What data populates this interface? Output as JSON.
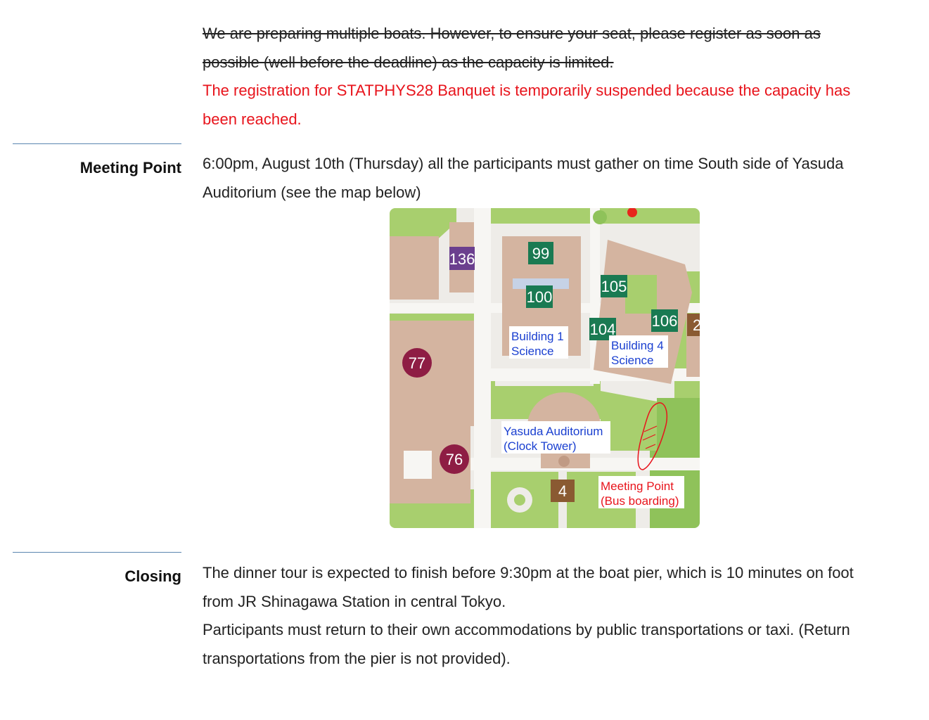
{
  "notice": {
    "strike_text": "We are preparing multiple boats. However, to ensure your seat, please register as soon as possible (well before the deadline) as the capacity is limited.",
    "suspended_text": "The registration for STATPHYS28 Banquet is temporarily suspended because the capacity has been reached."
  },
  "meeting": {
    "label": "Meeting Point",
    "text": "6:00pm, August 10th (Thursday) all the participants must gather on time South side of Yasuda Auditorium (see the map below)"
  },
  "map": {
    "badges": [
      {
        "text": "136",
        "color": "#6b3f8e"
      },
      {
        "text": "99",
        "color": "#1a7a52"
      },
      {
        "text": "100",
        "color": "#1a7a52"
      },
      {
        "text": "105",
        "color": "#1a7a52"
      },
      {
        "text": "106",
        "color": "#1a7a52"
      },
      {
        "text": "104",
        "color": "#1a7a52"
      },
      {
        "text": "2",
        "color": "#8a5a32"
      },
      {
        "text": "77",
        "color": "#8e1d44"
      },
      {
        "text": "76",
        "color": "#8e1d44"
      },
      {
        "text": "4",
        "color": "#8a5a32"
      }
    ],
    "building1": [
      "Building 1",
      "Science"
    ],
    "building4": [
      "Building 4",
      "Science"
    ],
    "yasuda": [
      "Yasuda Auditorium",
      "(Clock Tower)"
    ],
    "meeting_point": [
      "Meeting Point",
      "(Bus boarding)"
    ],
    "colors": {
      "building": "#d4b4a0",
      "park": "#a8cf6e",
      "road": "#f4f2ee",
      "label_blue": "#1a3fd0",
      "label_red": "#e8141c"
    }
  },
  "closing": {
    "label": "Closing",
    "text1": "The dinner tour is expected to finish before 9:30pm at the boat pier, which is 10 minutes on foot from JR Shinagawa Station in central Tokyo.",
    "text2": "Participants must return to their own accommodations by public transportations or taxi. (Return transportations from the pier is not provided)."
  }
}
